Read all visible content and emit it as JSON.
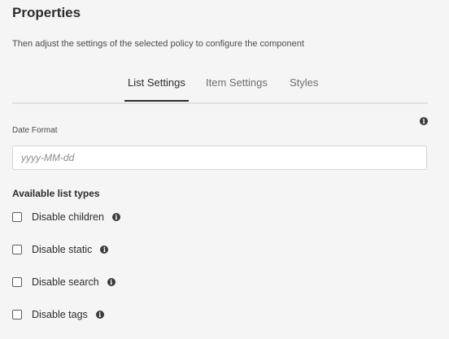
{
  "page": {
    "title": "Properties",
    "subtitle": "Then adjust the settings of the selected policy to configure the component"
  },
  "tabs": [
    {
      "label": "List Settings",
      "active": true
    },
    {
      "label": "Item Settings",
      "active": false
    },
    {
      "label": "Styles",
      "active": false
    }
  ],
  "date_format": {
    "label": "Date Format",
    "placeholder": "yyyy-MM-dd",
    "value": ""
  },
  "list_types": {
    "heading": "Available list types",
    "options": [
      {
        "label": "Disable children",
        "checked": false
      },
      {
        "label": "Disable static",
        "checked": false
      },
      {
        "label": "Disable search",
        "checked": false
      },
      {
        "label": "Disable tags",
        "checked": false
      }
    ]
  },
  "icons": {
    "info": "info-icon",
    "info_glyph": "i"
  },
  "colors": {
    "background": "#f5f5f5",
    "text": "#2c2c2c",
    "tab_underline": "#2c2c2c",
    "divider": "#e1e1e1"
  }
}
